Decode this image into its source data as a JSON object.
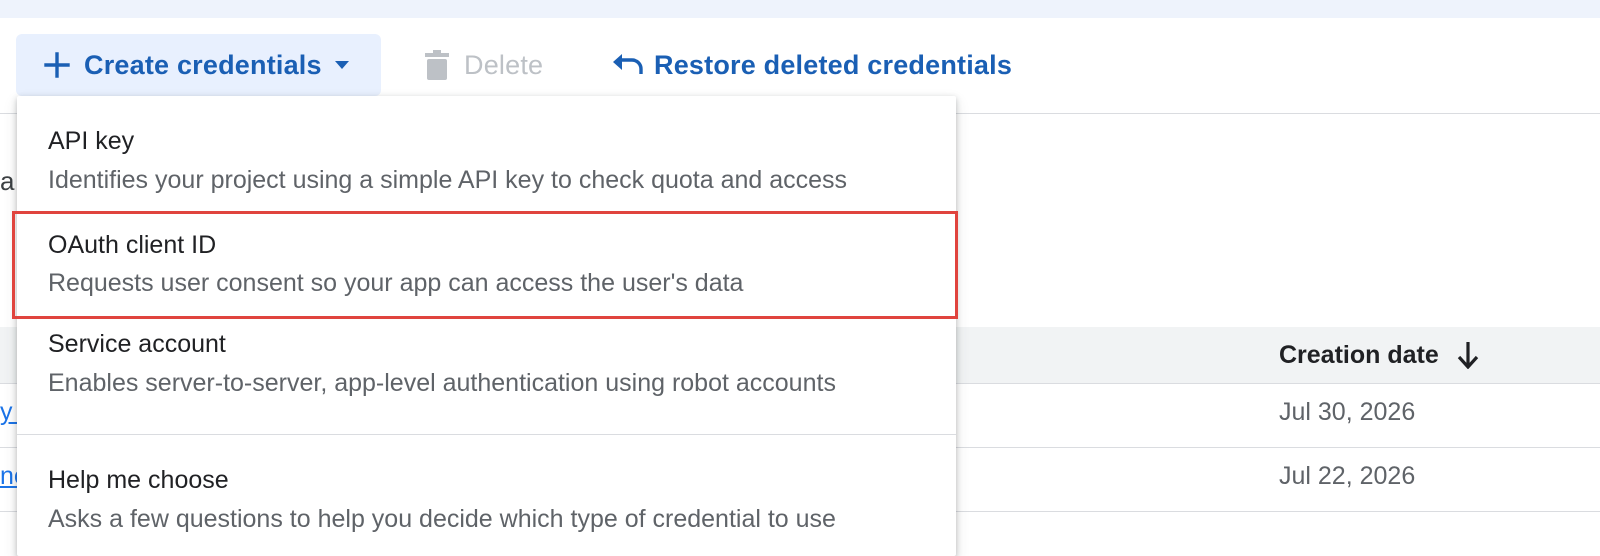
{
  "toolbar": {
    "create_label": "Create credentials",
    "delete_label": "Delete",
    "restore_label": "Restore deleted credentials"
  },
  "background": {
    "partial_text": "a",
    "table": {
      "creation_date_header": "Creation date",
      "rows": [
        {
          "link_fragment": "y T",
          "creation_date": "Jul 30, 2026"
        },
        {
          "link_fragment": "ne",
          "creation_date": "Jul 22, 2026"
        }
      ]
    }
  },
  "menu": {
    "items": [
      {
        "title": "API key",
        "description": "Identifies your project using a simple API key to check quota and access"
      },
      {
        "title": "OAuth client ID",
        "description": "Requests user consent so your app can access the user's data"
      },
      {
        "title": "Service account",
        "description": "Enables server-to-server, app-level authentication using robot accounts"
      },
      {
        "title": "Help me choose",
        "description": "Asks a few questions to help you decide which type of credential to use"
      }
    ]
  },
  "colors": {
    "primary_blue": "#1a5fb4",
    "create_button_bg": "#e8f0fe",
    "highlight_red": "#e0443e",
    "disabled_gray": "#bdc1c6"
  }
}
